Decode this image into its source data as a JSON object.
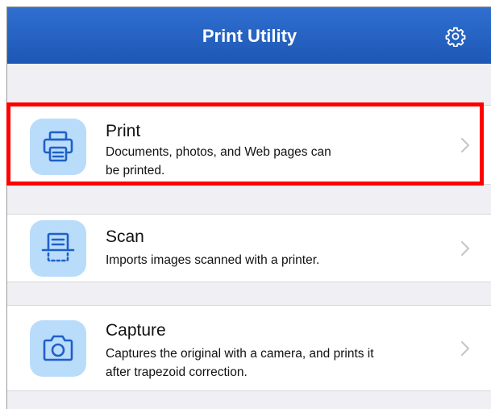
{
  "header": {
    "title": "Print Utility",
    "settings_icon": "gear-icon"
  },
  "menu": {
    "items": [
      {
        "id": "print",
        "title": "Print",
        "description_line1": "Documents, photos, and Web pages can",
        "description_line2": "be printed.",
        "icon": "printer-icon"
      },
      {
        "id": "scan",
        "title": "Scan",
        "description_line1": "Imports images scanned with a printer.",
        "icon": "scanner-icon"
      },
      {
        "id": "capture",
        "title": "Capture",
        "description_line1": "Captures the original with a camera, and prints it",
        "description_line2": "after trapezoid correction.",
        "icon": "camera-icon"
      }
    ]
  },
  "highlight": {
    "target": "print",
    "color": "#ff0000"
  },
  "colors": {
    "header_bg": "#1f5cbf",
    "icon_tile": "#b9dcfb",
    "icon_stroke": "#1f5fc8",
    "background": "#efeff4"
  }
}
